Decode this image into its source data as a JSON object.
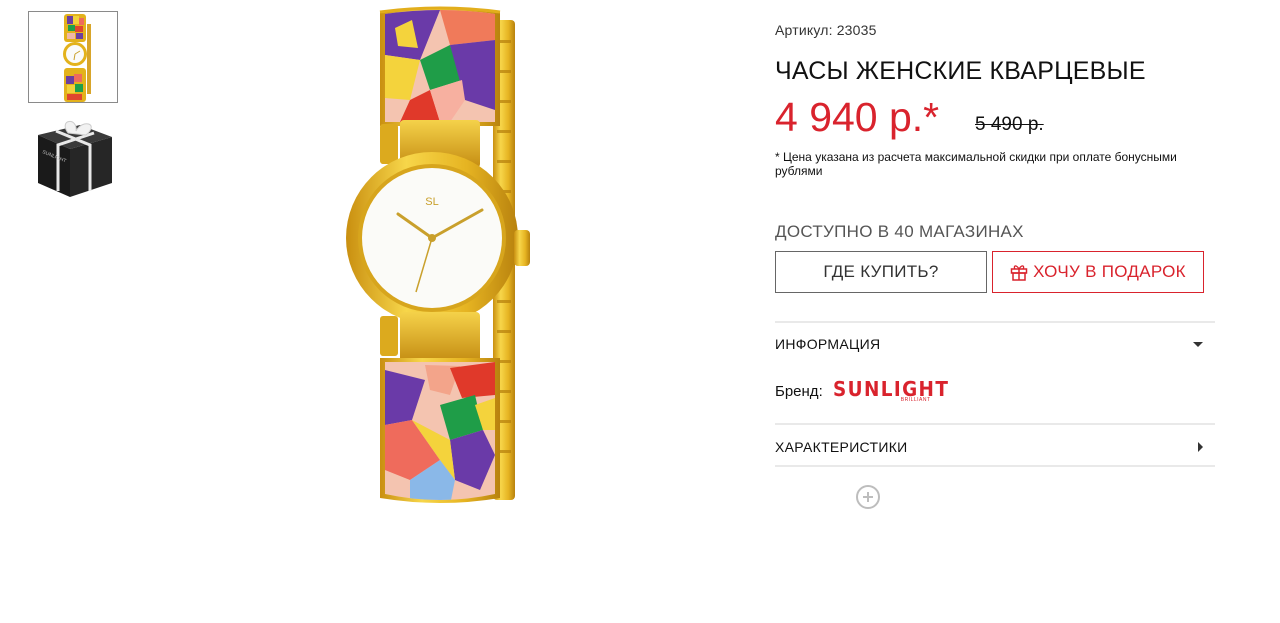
{
  "gallery": {
    "thumbnails": [
      {
        "name": "watch-thumbnail",
        "active": true
      },
      {
        "name": "gift-box-thumbnail",
        "active": false,
        "box_text": "SUNLIGHT"
      }
    ],
    "watch_face_logo": "SL",
    "zoom_icon": "zoom-in-icon"
  },
  "product": {
    "sku_label": "Артикул:",
    "sku_value": "23035",
    "title": "ЧАСЫ ЖЕНСКИЕ КВАРЦЕВЫЕ",
    "price": "4 940 р.*",
    "old_price": "5 490 р.",
    "price_note": "* Цена указана из расчета максимальной скидки при оплате бонусными рублями",
    "availability": "ДОСТУПНО В 40 МАГАЗИНАХ",
    "where_to_buy_label": "ГДЕ КУПИТЬ?",
    "gift_label": "ХОЧУ В ПОДАРОК",
    "gift_icon": "gift-icon"
  },
  "accordion": {
    "info_label": "ИНФОРМАЦИЯ",
    "brand_label": "Бренд:",
    "brand_logo": {
      "word": "SUNLIGHT",
      "sub": "BRILLIANT"
    },
    "specs_label": "ХАРАКТЕРИСТИКИ"
  },
  "colors": {
    "accent_red": "#d9232d",
    "gold": "#e3b21c"
  }
}
